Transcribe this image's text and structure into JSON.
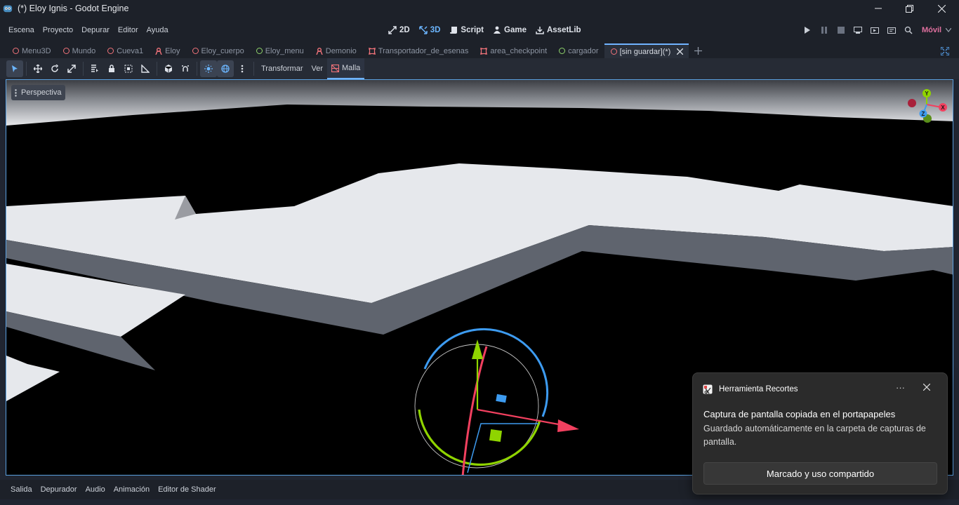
{
  "window": {
    "title": "(*) Eloy Ignis - Godot Engine",
    "controls": [
      "minimize",
      "restore",
      "close"
    ]
  },
  "menu": {
    "items": [
      "Escena",
      "Proyecto",
      "Depurar",
      "Editor",
      "Ayuda"
    ],
    "modes": [
      {
        "label": "2D",
        "icon": "2d-icon",
        "active": false
      },
      {
        "label": "3D",
        "icon": "3d-icon",
        "active": true
      },
      {
        "label": "Script",
        "icon": "script-icon",
        "active": false
      },
      {
        "label": "Game",
        "icon": "game-icon",
        "active": false
      },
      {
        "label": "AssetLib",
        "icon": "assetlib-icon",
        "active": false
      }
    ],
    "renderer": "Móvil"
  },
  "tabs": [
    {
      "label": "Menu3D",
      "icon": "node3d-ring"
    },
    {
      "label": "Mundo",
      "icon": "node3d-ring"
    },
    {
      "label": "Cueva1",
      "icon": "node3d-ring"
    },
    {
      "label": "Eloy",
      "icon": "character-icon"
    },
    {
      "label": "Eloy_cuerpo",
      "icon": "node3d-ring"
    },
    {
      "label": "Eloy_menu",
      "icon": "control-ring"
    },
    {
      "label": "Demonio",
      "icon": "character-icon"
    },
    {
      "label": "Transportador_de_esenas",
      "icon": "area-icon"
    },
    {
      "label": "area_checkpoint",
      "icon": "area-icon"
    },
    {
      "label": "cargador",
      "icon": "control-ring"
    },
    {
      "label": "[sin guardar](*)",
      "icon": "node3d-ring",
      "active": true
    }
  ],
  "toolbar": {
    "transform_label": "Transformar",
    "view_label": "Ver",
    "mesh_label": "Malla"
  },
  "viewport": {
    "perspective_label": "Perspectiva",
    "gizmo_axes": [
      "Y",
      "X",
      "Z"
    ]
  },
  "bottom_panel": [
    "Salida",
    "Depurador",
    "Audio",
    "Animación",
    "Editor de Shader"
  ],
  "notification": {
    "app_name": "Herramienta Recortes",
    "more": "···",
    "title": "Captura de pantalla copiada en el portapapeles",
    "body": "Guardado automáticamente en la carpeta de capturas de pantalla.",
    "action_label": "Marcado y uso compartido"
  },
  "colors": {
    "accent": "#70b3ff",
    "x_axis": "#f2405f",
    "y_axis": "#8fd400",
    "z_axis": "#3d9bf0"
  }
}
